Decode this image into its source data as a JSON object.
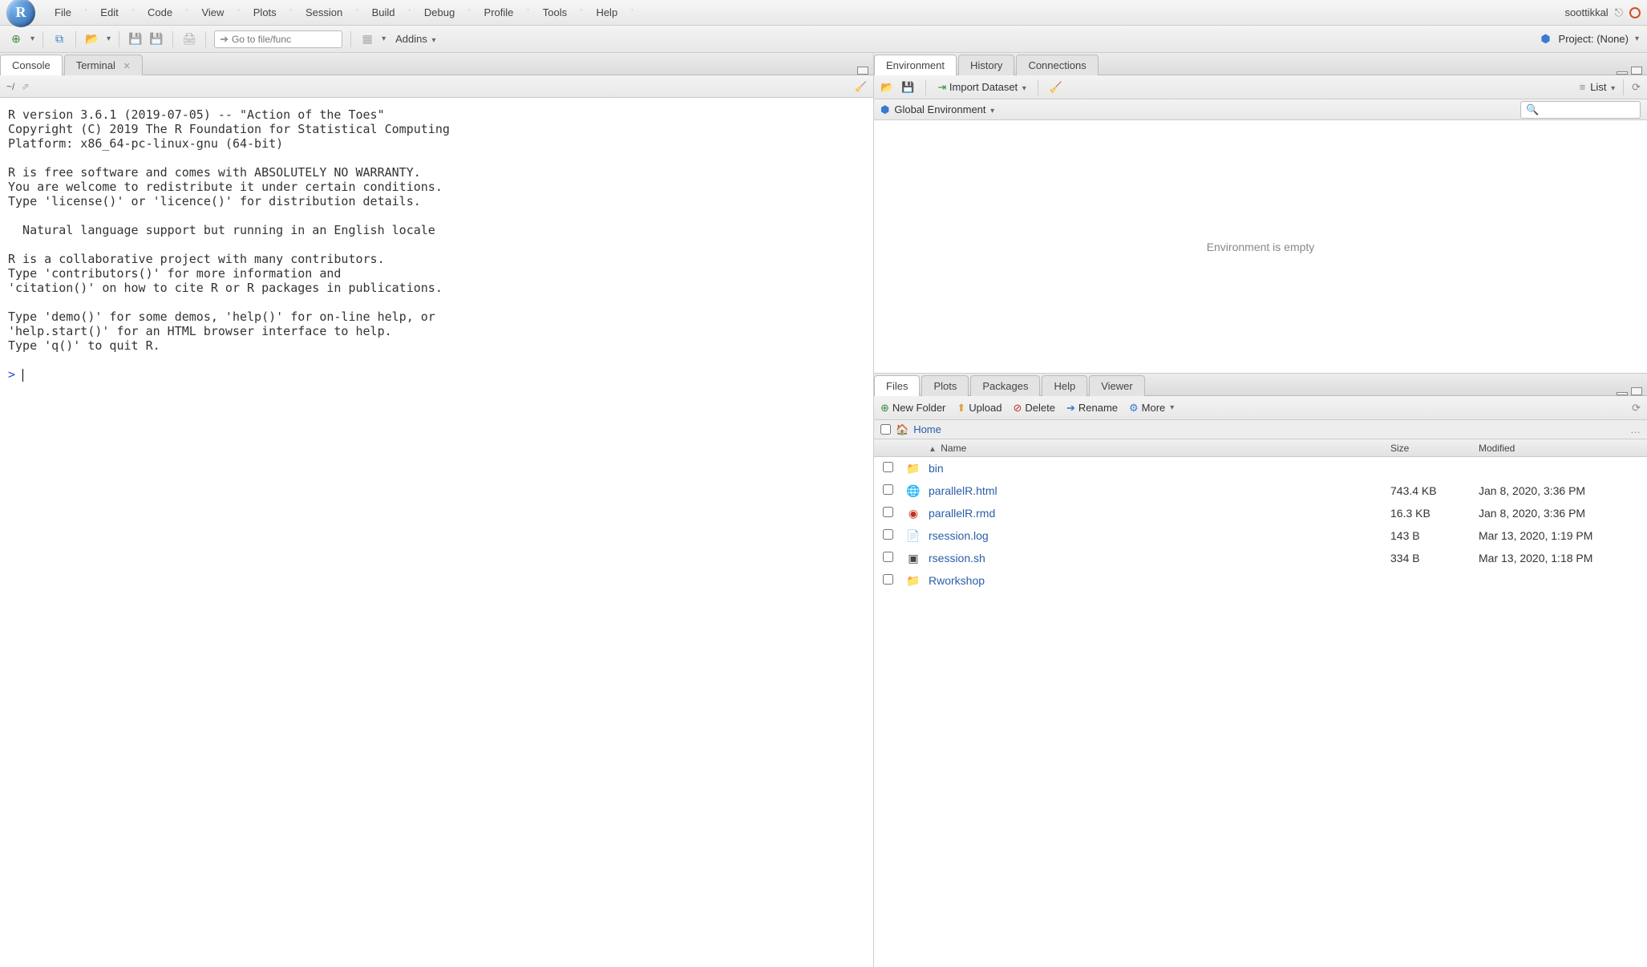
{
  "menubar": {
    "items": [
      "File",
      "Edit",
      "Code",
      "View",
      "Plots",
      "Session",
      "Build",
      "Debug",
      "Profile",
      "Tools",
      "Help"
    ],
    "username": "soottikkal"
  },
  "toolbar": {
    "goto_placeholder": "Go to file/func",
    "addins_label": "Addins",
    "project_label": "Project: (None)"
  },
  "console": {
    "tabs": [
      "Console",
      "Terminal"
    ],
    "active_tab": 0,
    "path": "~/",
    "body": "R version 3.6.1 (2019-07-05) -- \"Action of the Toes\"\nCopyright (C) 2019 The R Foundation for Statistical Computing\nPlatform: x86_64-pc-linux-gnu (64-bit)\n\nR is free software and comes with ABSOLUTELY NO WARRANTY.\nYou are welcome to redistribute it under certain conditions.\nType 'license()' or 'licence()' for distribution details.\n\n  Natural language support but running in an English locale\n\nR is a collaborative project with many contributors.\nType 'contributors()' for more information and\n'citation()' on how to cite R or R packages in publications.\n\nType 'demo()' for some demos, 'help()' for on-line help, or\n'help.start()' for an HTML browser interface to help.\nType 'q()' to quit R.\n",
    "prompt": ">"
  },
  "environment": {
    "tabs": [
      "Environment",
      "History",
      "Connections"
    ],
    "active_tab": 0,
    "import_label": "Import Dataset",
    "list_label": "List",
    "scope_label": "Global Environment",
    "empty_text": "Environment is empty"
  },
  "files": {
    "tabs": [
      "Files",
      "Plots",
      "Packages",
      "Help",
      "Viewer"
    ],
    "active_tab": 0,
    "toolbar": {
      "new_folder": "New Folder",
      "upload": "Upload",
      "delete": "Delete",
      "rename": "Rename",
      "more": "More"
    },
    "breadcrumb": {
      "home": "Home"
    },
    "columns": {
      "name": "Name",
      "size": "Size",
      "modified": "Modified"
    },
    "rows": [
      {
        "icon": "folder",
        "name": "bin",
        "size": "",
        "modified": "",
        "link": true
      },
      {
        "icon": "html",
        "name": "parallelR.html",
        "size": "743.4 KB",
        "modified": "Jan 8, 2020, 3:36 PM",
        "link": true
      },
      {
        "icon": "rmd",
        "name": "parallelR.rmd",
        "size": "16.3 KB",
        "modified": "Jan 8, 2020, 3:36 PM",
        "link": true
      },
      {
        "icon": "file",
        "name": "rsession.log",
        "size": "143 B",
        "modified": "Mar 13, 2020, 1:19 PM",
        "link": true
      },
      {
        "icon": "sh",
        "name": "rsession.sh",
        "size": "334 B",
        "modified": "Mar 13, 2020, 1:18 PM",
        "link": true
      },
      {
        "icon": "folder",
        "name": "Rworkshop",
        "size": "",
        "modified": "",
        "link": true
      }
    ]
  }
}
